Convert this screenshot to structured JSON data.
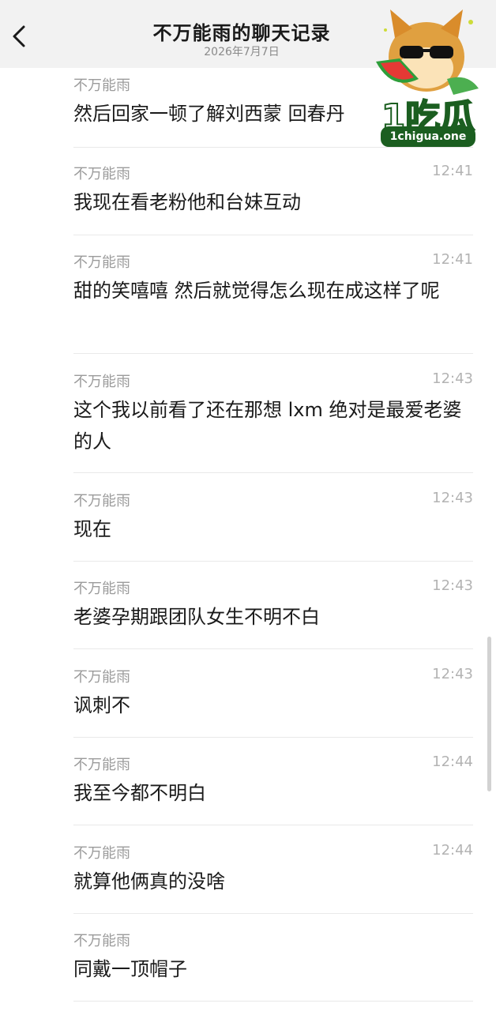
{
  "header": {
    "title": "不万能雨的聊天记录",
    "subtitle": "2026年7月7日",
    "back_icon": "chevron-left-icon"
  },
  "messages": [
    {
      "sender": "不万能雨",
      "time": "",
      "text": "然后回家一顿了解刘西蒙 回春丹"
    },
    {
      "sender": "不万能雨",
      "time": "12:41",
      "text": "我现在看老粉他和台妹互动"
    },
    {
      "sender": "不万能雨",
      "time": "12:41",
      "text": "甜的笑嘻嘻 然后就觉得怎么现在成这样了呢"
    },
    {
      "sender": "不万能雨",
      "time": "12:43",
      "text": "这个我以前看了还在那想 lxm 绝对是最爱老婆的人"
    },
    {
      "sender": "不万能雨",
      "time": "12:43",
      "text": "现在"
    },
    {
      "sender": "不万能雨",
      "time": "12:43",
      "text": "老婆孕期跟团队女生不明不白"
    },
    {
      "sender": "不万能雨",
      "time": "12:43",
      "text": "讽刺不"
    },
    {
      "sender": "不万能雨",
      "time": "12:44",
      "text": "我至今都不明白"
    },
    {
      "sender": "不万能雨",
      "time": "12:44",
      "text": "就算他俩真的没啥"
    },
    {
      "sender": "不万能雨",
      "time": "",
      "text": "同戴一顶帽子"
    }
  ],
  "watermark": {
    "brand": "1吃瓜",
    "domain": "1chigua.one"
  },
  "colors": {
    "header_bg": "#f2f2f2",
    "text": "#1a1a1a",
    "sender": "#9b9b9b",
    "time": "#b3b3b3",
    "divider": "#e9e9e9",
    "logo_green": "#1b5e20"
  }
}
